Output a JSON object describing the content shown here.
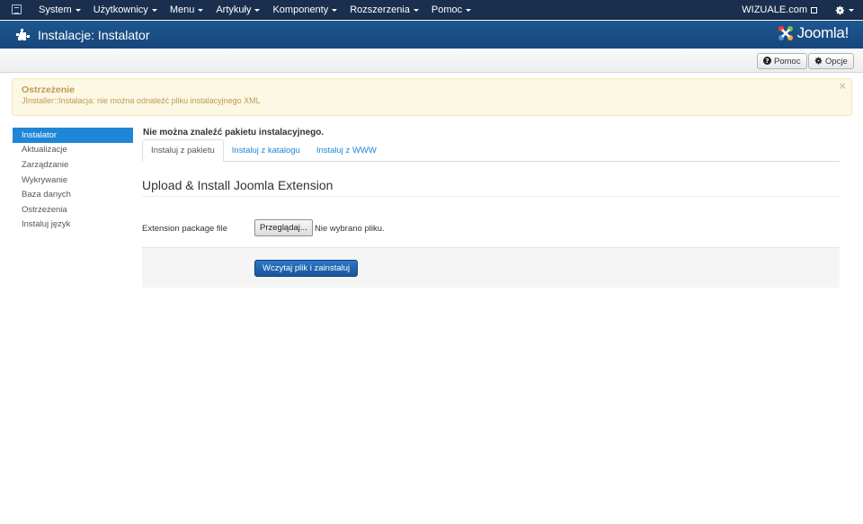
{
  "navbar": {
    "menu": [
      {
        "label": "System"
      },
      {
        "label": "Użytkownicy"
      },
      {
        "label": "Menu"
      },
      {
        "label": "Artykuły"
      },
      {
        "label": "Komponenty"
      },
      {
        "label": "Rozszerzenia"
      },
      {
        "label": "Pomoc"
      }
    ],
    "site_name": "WIZUALE.com"
  },
  "header": {
    "title": "Instalacje: Instalator",
    "logo_text": "Joomla!"
  },
  "toolbar": {
    "help_label": "Pomoc",
    "options_label": "Opcje"
  },
  "alert": {
    "heading": "Ostrzeżenie",
    "message": "JInstaller::Instalacja: nie można odnaleźć pliku instalacyjnego XML",
    "close": "×"
  },
  "sidebar": {
    "items": [
      {
        "label": "Instalator",
        "active": true
      },
      {
        "label": "Aktualizacje"
      },
      {
        "label": "Zarządzanie"
      },
      {
        "label": "Wykrywanie"
      },
      {
        "label": "Baza danych"
      },
      {
        "label": "Ostrzeżenia"
      },
      {
        "label": "Instaluj język"
      }
    ]
  },
  "main": {
    "error_title": "Nie można znaleźć pakietu instalacyjnego.",
    "tabs": [
      {
        "label": "Instaluj z pakietu",
        "active": true
      },
      {
        "label": "Instaluj z katalogu"
      },
      {
        "label": "Instaluj z WWW"
      }
    ],
    "section_title": "Upload & Install Joomla Extension",
    "field_label": "Extension package file",
    "browse_label": "Przeglądaj...",
    "file_status": "Nie wybrano pliku.",
    "submit_label": "Wczytaj plik i zainstaluj"
  },
  "colors": {
    "navbar_bg": "#1a2f4d",
    "header_bg": "#1c4f85",
    "accent": "#1e86d6",
    "warning_text": "#c09853",
    "warning_bg": "#fcf8e3"
  },
  "icons": [
    "joomla-admin-icon",
    "caret-down-icon",
    "external-link-icon",
    "gear-icon",
    "puzzle-icon",
    "question-circle-icon",
    "joomla-logo-icon"
  ]
}
